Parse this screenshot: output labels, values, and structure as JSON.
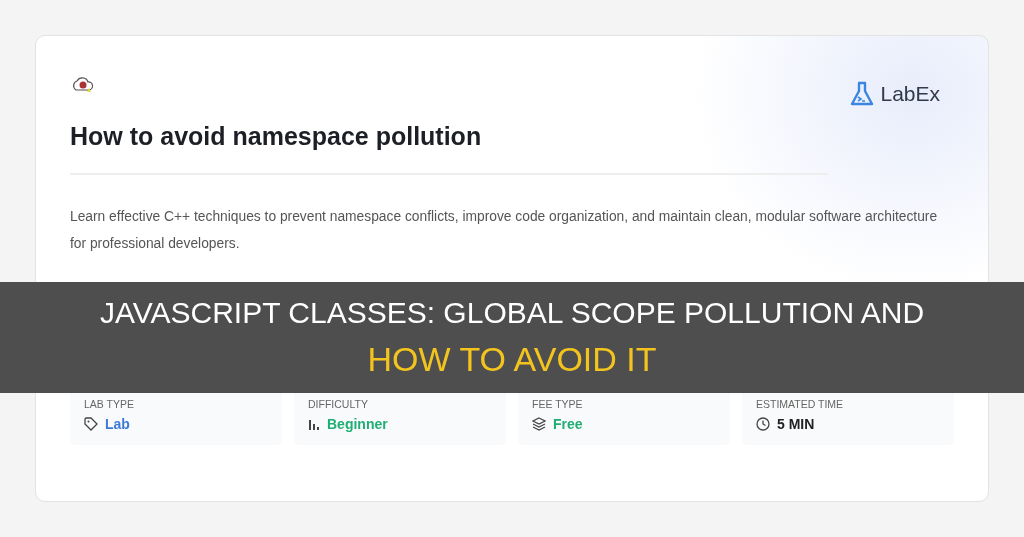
{
  "card": {
    "title": "How to avoid namespace pollution",
    "brand": "LabEx",
    "description": "Learn effective C++ techniques to prevent namespace conflicts, improve code organization, and maintain clean, modular software architecture for professional developers.",
    "info": [
      {
        "kind": "tag",
        "label": "LAB TYPE",
        "value": "Lab",
        "color": "#3f7bd6"
      },
      {
        "kind": "bars",
        "label": "DIFFICULTY",
        "value": "Beginner",
        "color": "#1fae74"
      },
      {
        "kind": "layers",
        "label": "FEE TYPE",
        "value": "Free",
        "color": "#1fae74"
      },
      {
        "kind": "clock",
        "label": "ESTIMATED TIME",
        "value": "5 MIN",
        "color": "#222222"
      }
    ]
  },
  "banner": {
    "line_1": "JAVASCRIPT CLASSES: GLOBAL SCOPE POLLUTION AND",
    "line_2": "HOW TO AVOID IT"
  }
}
